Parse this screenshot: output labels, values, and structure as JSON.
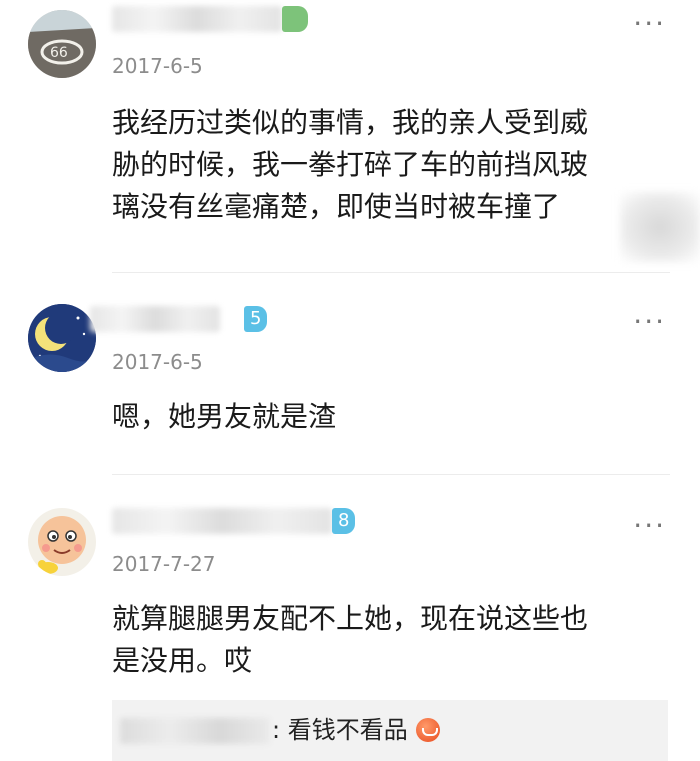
{
  "comments": [
    {
      "date": "2017-6-5",
      "text_lines": [
        "我经历过类似的事情，我的亲人受到威",
        "胁的时候，我一拳打碎了车的前挡风玻",
        "璃没有丝毫痛楚，即使当时被车撞了"
      ],
      "badge": "",
      "badge_color": "#7dc37a"
    },
    {
      "date": "2017-6-5",
      "text_lines": [
        "嗯，她男友就是渣"
      ],
      "badge": "5",
      "badge_color": "#5bc0e6"
    },
    {
      "date": "2017-7-27",
      "text_lines": [
        "就算腿腿男友配不上她，现在说这些也",
        "是没用。哎"
      ],
      "badge": "8",
      "badge_color": "#5bc0e6"
    }
  ],
  "reply": {
    "text": ": 看钱不看品",
    "emoji_icon": "grin-emoji-icon"
  },
  "more_icon_glyph": "···"
}
